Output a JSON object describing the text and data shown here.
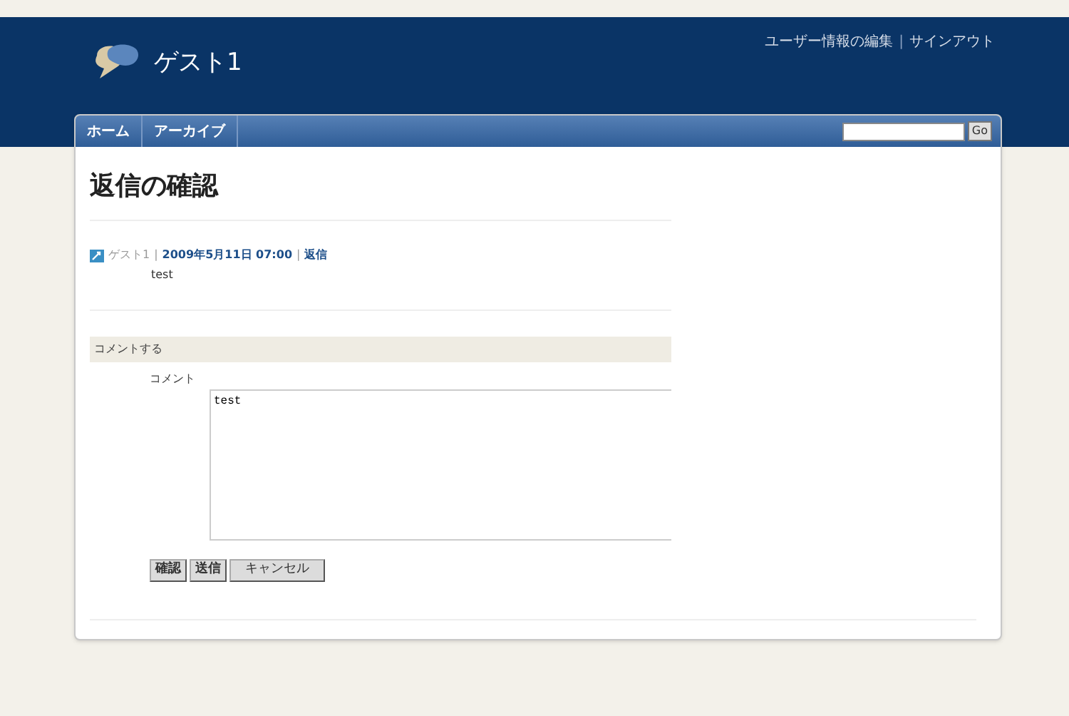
{
  "header": {
    "site_title": "ゲスト1",
    "links": [
      "ユーザー情報の編集",
      "サインアウト"
    ],
    "separator": "|"
  },
  "nav": {
    "items": [
      {
        "label": "ホーム",
        "selected": false
      },
      {
        "label": "アーカイブ",
        "selected": false
      }
    ],
    "search_button": "Go"
  },
  "page_title": "返信の確認",
  "post": {
    "author": "ゲスト1",
    "date": "2009年5月11日 07:00",
    "reply_link": "返信",
    "separator": "|",
    "body": "test"
  },
  "comment_form": {
    "section_title": "コメントする",
    "label": "コメント",
    "value": "test",
    "buttons": [
      "確認",
      "送信",
      "キャンセル"
    ]
  }
}
